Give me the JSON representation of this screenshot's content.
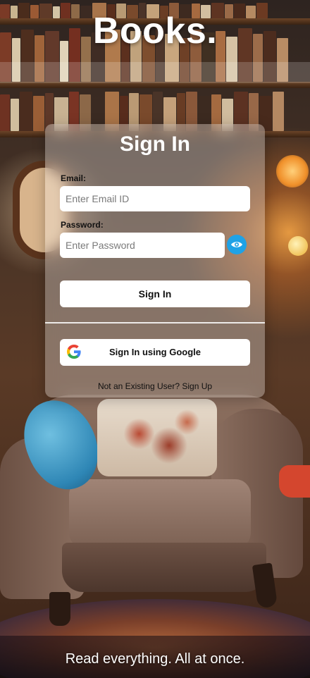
{
  "brand": {
    "title": "Books."
  },
  "login": {
    "heading": "Sign In",
    "email_label": "Email:",
    "email_placeholder": "Enter Email ID",
    "email_value": "",
    "password_label": "Password:",
    "password_placeholder": "Enter Password",
    "password_value": "",
    "toggle_icon": "eye-icon",
    "submit_label": "Sign In",
    "google_label": "Sign In using Google",
    "google_icon": "google-logo-icon",
    "signup_prompt": "Not an Existing User?",
    "signup_link": "Sign Up"
  },
  "footer": {
    "tagline": "Read everything. All at once."
  },
  "colors": {
    "accent": "#1fa2e6",
    "card_bg": "rgba(255,255,255,0.30)",
    "button_bg": "#ffffff",
    "heading_text": "#ffffff"
  }
}
